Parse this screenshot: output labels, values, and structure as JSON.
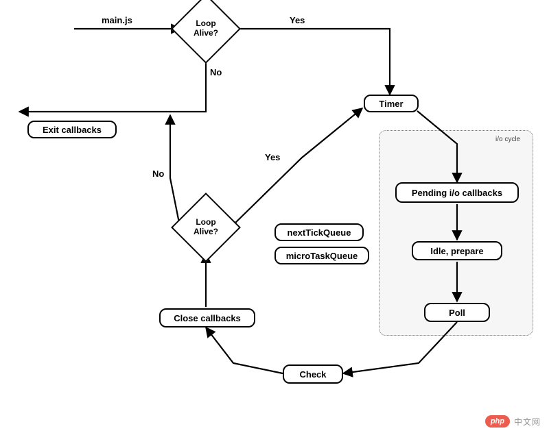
{
  "nodes": {
    "loop1": "Loop\nAlive?",
    "loop2": "Loop\nAlive?",
    "timer": "Timer",
    "pending": "Pending i/o callbacks",
    "idle": "Idle, prepare",
    "poll": "Poll",
    "check": "Check",
    "close": "Close callbacks",
    "exit": "Exit callbacks",
    "nexttick": "nextTickQueue",
    "microtask": "microTaskQueue"
  },
  "labels": {
    "mainjs": "main.js",
    "yes_top": "Yes",
    "no_top": "No",
    "yes_mid": "Yes",
    "no_mid": "No",
    "iocycle": "i/o cycle"
  },
  "watermark": {
    "logo": "php",
    "text": "中文网"
  }
}
